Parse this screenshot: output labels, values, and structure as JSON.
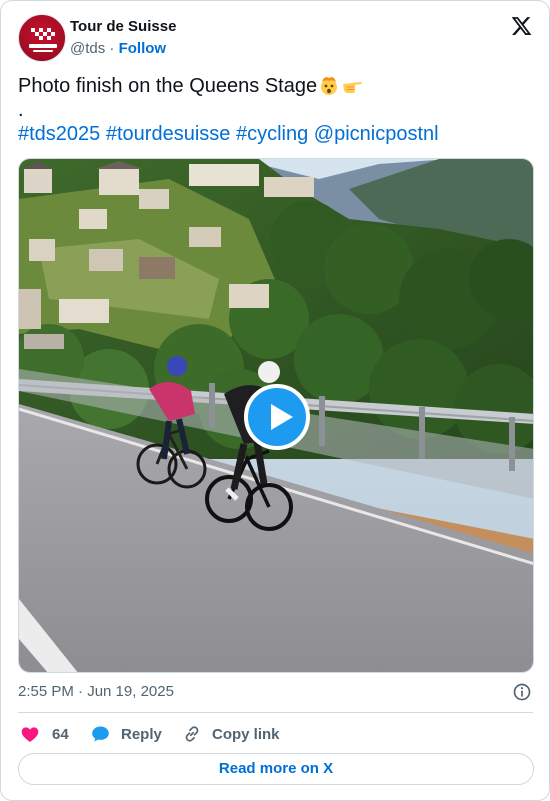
{
  "author": {
    "name": "Tour de Suisse",
    "handle": "@tds",
    "separator": "·",
    "follow_label": "Follow",
    "avatar_icon": "tour-de-suisse-logo"
  },
  "tweet": {
    "line1": "Photo finish on the Queens Stage",
    "line1_emojis": [
      "exploding-head-emoji",
      "pointing-hand-emoji"
    ],
    "line2": ".",
    "hashtags": [
      "#tds2025",
      "#tourdesuisse",
      "#cycling",
      "@picnicpostnl"
    ]
  },
  "media": {
    "type": "video",
    "play_icon": "play-icon"
  },
  "meta": {
    "timestamp": "2:55 PM · Jun 19, 2025"
  },
  "actions": {
    "like_count": "64",
    "reply_label": "Reply",
    "copy_label": "Copy link"
  },
  "footer": {
    "read_more_label": "Read more on X"
  },
  "colors": {
    "link": "#006fd6",
    "like": "#f91880",
    "reply_icon": "#1d9bf0",
    "play_button": "#1d9bf0",
    "secondary_text": "#536471",
    "border": "#cfd9de"
  }
}
